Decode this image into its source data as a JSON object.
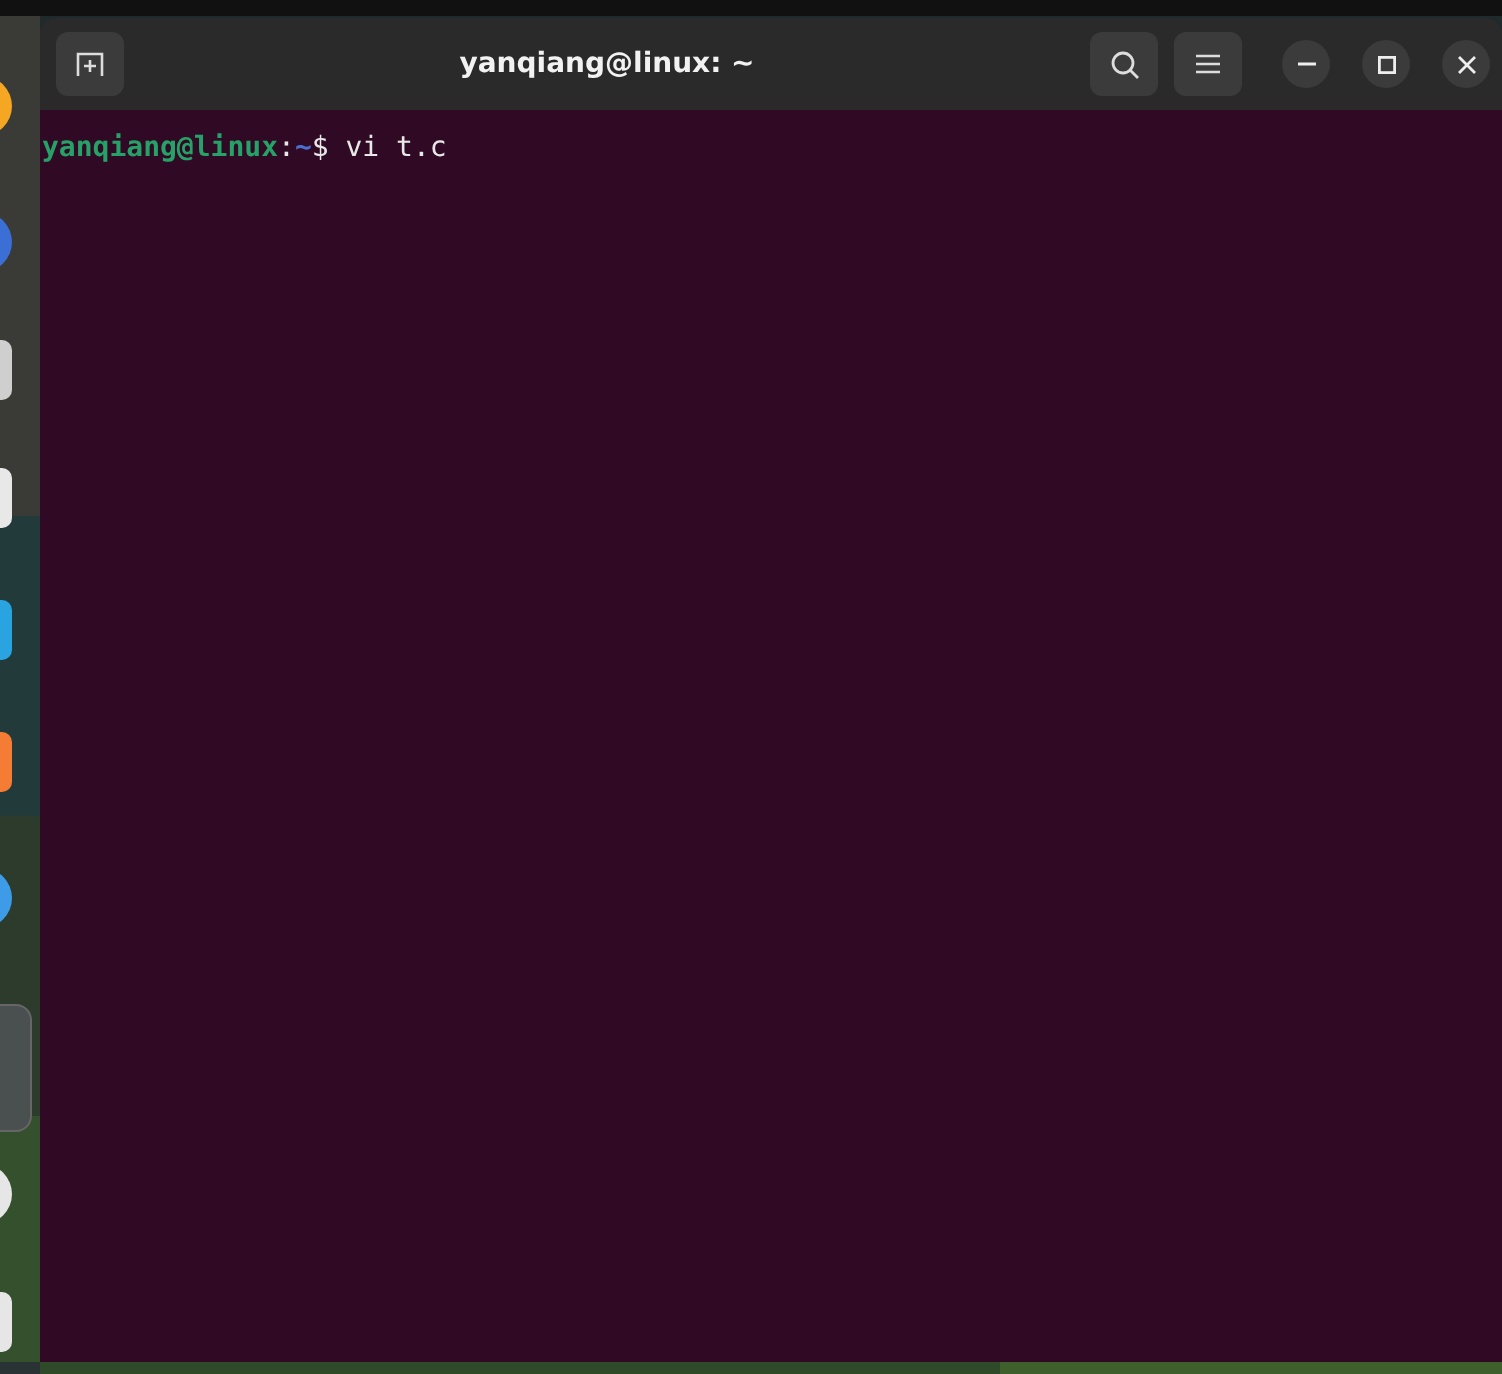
{
  "window": {
    "title": "yanqiang@linux: ~"
  },
  "terminal": {
    "lines": [
      {
        "user_host": "yanqiang@linux",
        "separator": ":",
        "path": "~",
        "prompt": "$",
        "command": " vi t.c"
      }
    ]
  }
}
